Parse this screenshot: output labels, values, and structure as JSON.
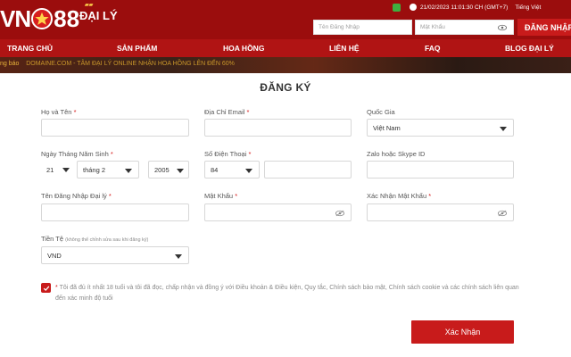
{
  "brand": {
    "logo_left": "VN",
    "logo_right": "88",
    "logo_sub": "ĐẠI LÝ"
  },
  "topbar": {
    "datetime": "21/02/2023 11:01:30 CH (GMT+7)",
    "language": "Tiếng Việt"
  },
  "login": {
    "username_placeholder": "Tên Đăng Nhập",
    "password_placeholder": "Mật Khẩu",
    "button": "ĐĂNG NHẬP"
  },
  "nav": [
    {
      "label": "TRANG CHỦ"
    },
    {
      "label": "SẢN PHẨM"
    },
    {
      "label": "HOA HỒNG"
    },
    {
      "label": "LIÊN HỆ"
    },
    {
      "label": "FAQ"
    },
    {
      "label": "BLOG ĐẠI LÝ"
    }
  ],
  "marquee": {
    "lead": "ng báo",
    "text": "DOMAINE.COM - TÂM ĐẠI LÝ ONLINE NHẬN HOA HỒNG LÊN ĐẾN 60%"
  },
  "form": {
    "title": "ĐĂNG KÝ",
    "full_name": {
      "label": "Họ và Tên",
      "value": ""
    },
    "email": {
      "label": "Địa Chỉ Email",
      "value": ""
    },
    "country": {
      "label": "Quốc Gia",
      "value": "Việt Nam"
    },
    "dob": {
      "label": "Ngày Tháng Năm Sinh",
      "day": "21",
      "month": "tháng 2",
      "year": "2005"
    },
    "phone": {
      "label": "Số Điện Thoại",
      "code": "84",
      "value": ""
    },
    "social": {
      "label": "Zalo hoặc Skype ID",
      "value": ""
    },
    "agent_username": {
      "label": "Tên Đăng Nhập Đại lý",
      "value": ""
    },
    "password": {
      "label": "Mật Khẩu",
      "value": ""
    },
    "confirm_password": {
      "label": "Xác Nhận Mật Khẩu",
      "value": ""
    },
    "currency": {
      "label": "Tiền Tệ",
      "hint": "(không thể chỉnh sửa sau khi đăng ký)",
      "value": "VND"
    },
    "required_mark": "*",
    "terms": "Tôi đã đủ ít nhất 18 tuổi và tôi đã đọc, chấp nhận và đồng ý với Điều khoản & Điều kiện, Quy tắc, Chính sách bảo mật, Chính sách cookie và các chính sách liên quan đến xác minh độ tuổi",
    "terms_checked": true,
    "submit": "Xác Nhận"
  },
  "colors": {
    "brand_red": "#9b0d0d",
    "nav_red": "#b01414",
    "accent": "#c81b1b"
  }
}
